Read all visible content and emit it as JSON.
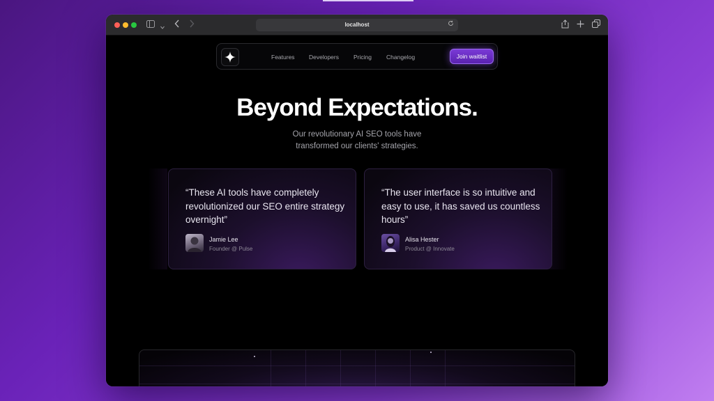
{
  "browser": {
    "url": "localhost",
    "icons": [
      "sidebar-icon",
      "chevron-down-icon",
      "back-icon",
      "forward-icon",
      "reload-icon",
      "share-icon",
      "new-tab-icon",
      "tabs-overview-icon"
    ]
  },
  "nav": {
    "logo_icon": "sparkle-icon",
    "links": [
      "Features",
      "Developers",
      "Pricing",
      "Changelog"
    ],
    "cta": "Join waitlist"
  },
  "hero": {
    "title": "Beyond Expectations.",
    "subtitle_line1": "Our revolutionary AI SEO tools have",
    "subtitle_line2": "transformed our clients' strategies."
  },
  "testimonials": [
    {
      "quote": "“These AI tools have completely revolutionized our SEO entire strategy overnight”",
      "name": "Jamie Lee",
      "role": "Founder @ Pulse"
    },
    {
      "quote": "“The user interface is so intuitive and easy to use, it has saved us countless hours”",
      "name": "Alisa Hester",
      "role": "Product @ Innovate"
    }
  ],
  "colors": {
    "accent": "#7a3ad6",
    "background": "#000000"
  }
}
